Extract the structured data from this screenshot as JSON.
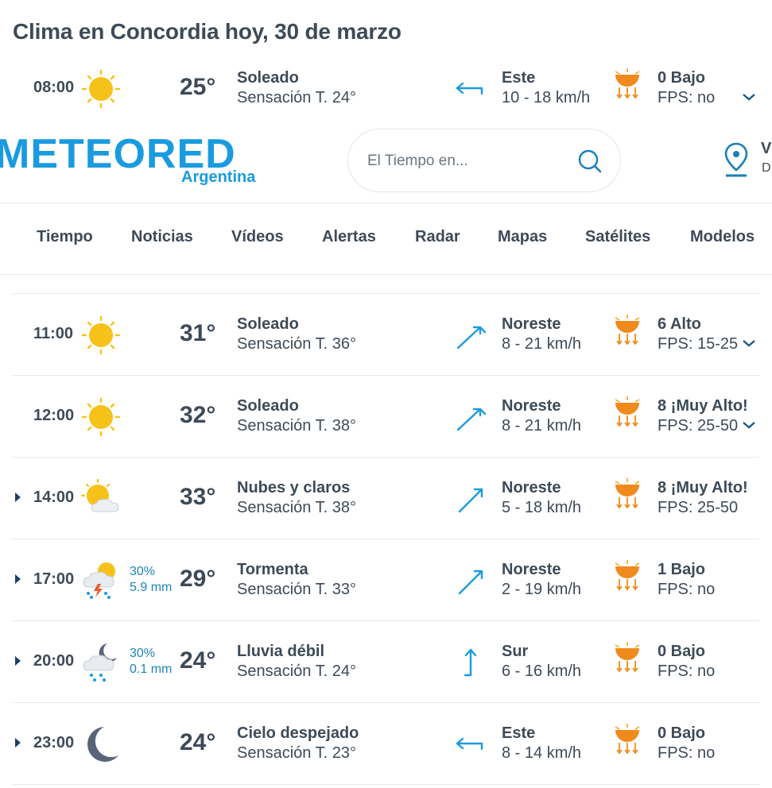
{
  "title": "Clima en Concordia hoy, 30 de marzo",
  "header": {
    "logo": "METEORED",
    "logo_sub": "Argentina",
    "search_placeholder": "El Tiempo en...",
    "location_line1": "V",
    "location_line2": "D"
  },
  "nav": [
    "Tiempo",
    "Noticias",
    "Vídeos",
    "Alertas",
    "Radar",
    "Mapas",
    "Satélites",
    "Modelos"
  ],
  "rows": [
    {
      "hour": "08:00",
      "icon": "sun-icon",
      "temp": "25°",
      "desc": "Soleado",
      "feel": "Sensación T. 24°",
      "wind_dir": "Este",
      "wind_speed": "10 - 18 km/h",
      "wind_icon": "wind-east-arrow-icon",
      "uv": "0 Bajo",
      "fps": "FPS: no",
      "chevron": true,
      "expander": false
    },
    {
      "hour": "11:00",
      "icon": "sun-icon",
      "temp": "31°",
      "desc": "Soleado",
      "feel": "Sensación T. 36°",
      "wind_dir": "Noreste",
      "wind_speed": "8 - 21 km/h",
      "wind_icon": "wind-northeast-arrow-icon",
      "uv": "6 Alto",
      "fps": "FPS: 15-25",
      "chevron": true,
      "expander": false
    },
    {
      "hour": "12:00",
      "icon": "sun-icon",
      "temp": "32°",
      "desc": "Soleado",
      "feel": "Sensación T. 38°",
      "wind_dir": "Noreste",
      "wind_speed": "8 - 21 km/h",
      "wind_icon": "wind-northeast-arrow-icon",
      "uv": "8 ¡Muy Alto!",
      "fps": "FPS: 25-50",
      "chevron": true,
      "expander": false
    },
    {
      "hour": "14:00",
      "icon": "sun-cloud-icon",
      "temp": "33°",
      "desc": "Nubes y claros",
      "feel": "Sensación T. 38°",
      "wind_dir": "Noreste",
      "wind_speed": "5 - 18 km/h",
      "wind_icon": "wind-northeast-arrow-icon",
      "uv": "8 ¡Muy Alto!",
      "fps": "FPS: 25-50",
      "chevron": false,
      "expander": true
    },
    {
      "hour": "17:00",
      "icon": "storm-icon",
      "precip_prob": "30%",
      "precip_mm": "5.9 mm",
      "temp": "29°",
      "desc": "Tormenta",
      "feel": "Sensación T. 33°",
      "wind_dir": "Noreste",
      "wind_speed": "2 - 19 km/h",
      "wind_icon": "wind-northeast-arrow-icon",
      "uv": "1 Bajo",
      "fps": "FPS: no",
      "chevron": false,
      "expander": true
    },
    {
      "hour": "20:00",
      "icon": "night-rain-icon",
      "precip_prob": "30%",
      "precip_mm": "0.1 mm",
      "temp": "24°",
      "desc": "Lluvia débil",
      "feel": "Sensación T. 24°",
      "wind_dir": "Sur",
      "wind_speed": "6 - 16 km/h",
      "wind_icon": "wind-south-arrow-icon",
      "uv": "0 Bajo",
      "fps": "FPS: no",
      "chevron": false,
      "expander": true
    },
    {
      "hour": "23:00",
      "icon": "moon-icon",
      "temp": "24°",
      "desc": "Cielo despejado",
      "feel": "Sensación T. 23°",
      "wind_dir": "Este",
      "wind_speed": "8 - 14 km/h",
      "wind_icon": "wind-east-arrow-icon",
      "uv": "0 Bajo",
      "fps": "FPS: no",
      "chevron": false,
      "expander": true
    }
  ],
  "colors": {
    "text": "#3d4a58",
    "accent_blue": "#1a9be0",
    "precip_blue": "#1f84b8",
    "sun_yellow": "#f6c21a",
    "uv_orange": "#f08a1c",
    "divider": "#e6e9ec"
  }
}
